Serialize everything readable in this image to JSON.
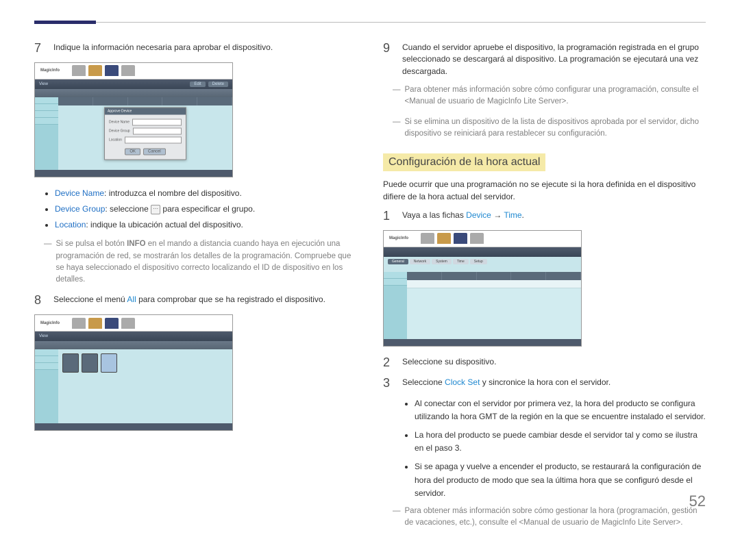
{
  "pageNumber": "52",
  "left": {
    "step7": {
      "num": "7",
      "text": "Indique la información necesaria para aprobar el dispositivo."
    },
    "shot1": {
      "logo": "MagicInfo",
      "toolbar": {
        "view": "View",
        "btn1": "Edit",
        "btn2": "Delete"
      },
      "dialog": {
        "title": "Approve Device",
        "row1": "Device Name",
        "row2": "Device Group",
        "row3": "Location",
        "ok": "OK",
        "cancel": "Cancel"
      }
    },
    "bullets": {
      "b1_label": "Device Name",
      "b1_text": ": introduzca el nombre del dispositivo.",
      "b2_label": "Device Group",
      "b2_text_a": ": seleccione ",
      "b2_text_b": " para especificar el grupo.",
      "b3_label": "Location",
      "b3_text": ": indique la ubicación actual del dispositivo."
    },
    "dashNote1": {
      "pre": "Si se pulsa el botón ",
      "info": "INFO",
      "post": " en el mando a distancia cuando haya en ejecución una programación de red, se mostrarán los detalles de la programación. Compruebe que se haya seleccionado el dispositivo correcto localizando el ID de dispositivo en los detalles."
    },
    "step8": {
      "num": "8",
      "pre": "Seleccione el menú ",
      "all": "All",
      "post": " para comprobar que se ha registrado el dispositivo."
    },
    "shot2": {
      "logo": "MagicInfo",
      "toolbar": {
        "view": "View"
      }
    }
  },
  "right": {
    "step9": {
      "num": "9",
      "text": "Cuando el servidor apruebe el dispositivo, la programación registrada en el grupo seleccionado se descargará al dispositivo. La programación se ejecutará una vez descargada."
    },
    "dashNote2": "Para obtener más información sobre cómo configurar una programación, consulte el <Manual de usuario de MagicInfo Lite Server>.",
    "dashNote3": "Si se elimina un dispositivo de la lista de dispositivos aprobada por el servidor, dicho dispositivo se reiniciará para restablecer su configuración.",
    "heading": "Configuración de la hora actual",
    "intro": "Puede ocurrir que una programación no se ejecute si la hora definida en el dispositivo difiere de la hora actual del servidor.",
    "step1": {
      "num": "1",
      "pre": "Vaya a las fichas ",
      "device": "Device",
      "arrow": " → ",
      "time": "Time",
      "post": "."
    },
    "shot3": {
      "logo": "MagicInfo",
      "pills": {
        "p1": "General",
        "p2": "Network",
        "p3": "System",
        "p4": "Time",
        "p5": "Setup"
      }
    },
    "step2": {
      "num": "2",
      "text": "Seleccione su dispositivo."
    },
    "step3": {
      "num": "3",
      "pre": "Seleccione ",
      "clock": "Clock Set",
      "post": " y sincronice la hora con el servidor."
    },
    "finalBullets": {
      "b1": "Al conectar con el servidor por primera vez, la hora del producto se configura utilizando la hora GMT de la región en la que se encuentre instalado el servidor.",
      "b2": "La hora del producto se puede cambiar desde el servidor tal y como se ilustra en el paso 3.",
      "b3": "Si se apaga y vuelve a encender el producto, se restaurará la configuración de hora del producto de modo que sea la última hora que se configuró desde el servidor."
    },
    "dashNote4": "Para obtener más información sobre cómo gestionar la hora (programación, gestión de vacaciones, etc.), consulte el <Manual de usuario de MagicInfo Lite Server>."
  }
}
